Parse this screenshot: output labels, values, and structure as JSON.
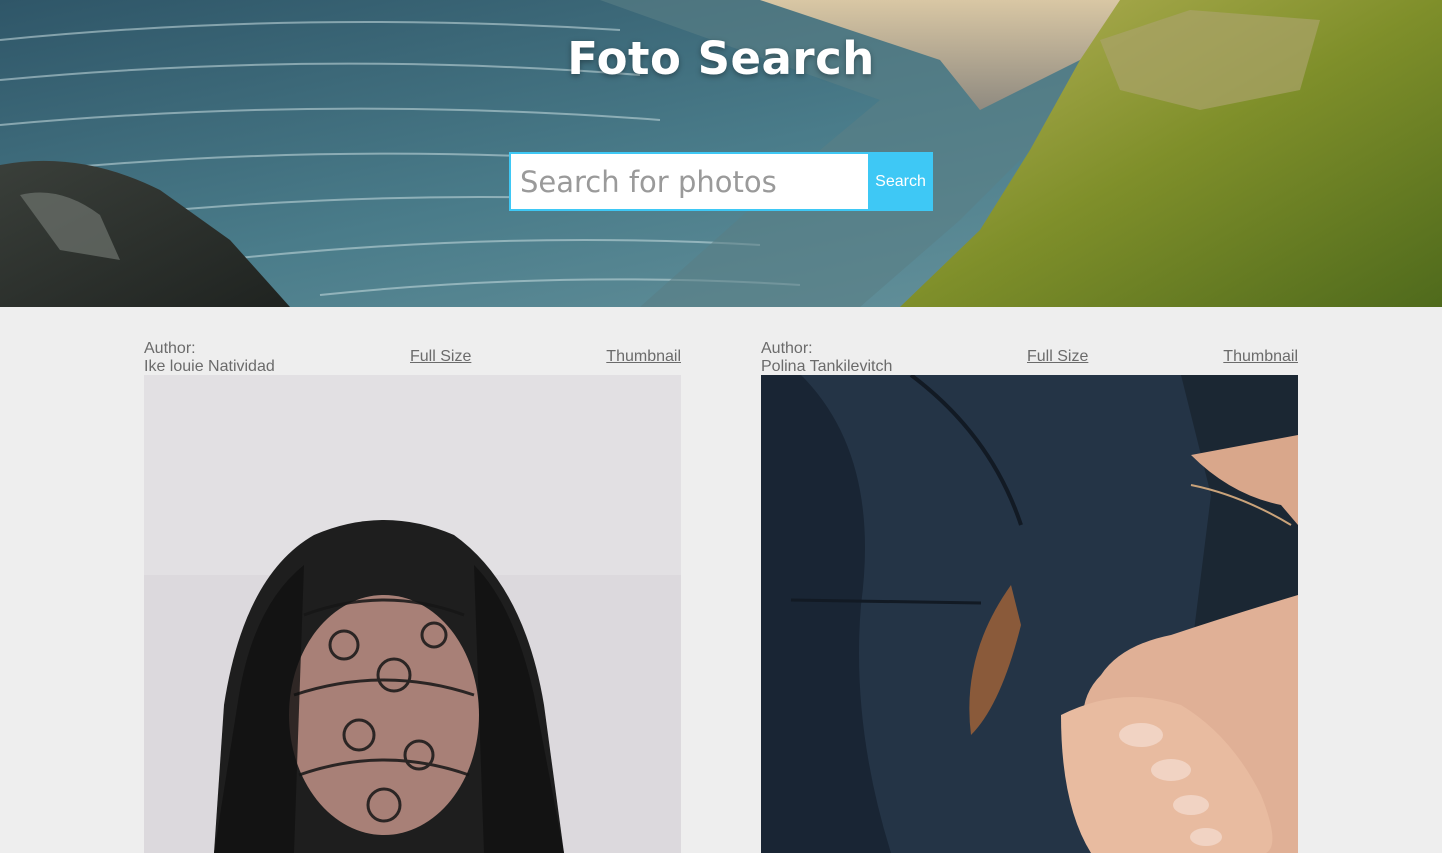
{
  "header": {
    "title": "Foto Search"
  },
  "search": {
    "placeholder": "Search for photos",
    "value": "",
    "button_label": "Search"
  },
  "colors": {
    "accent": "#3ec8f5",
    "page_background": "#eeeeee",
    "meta_text": "#6b6b6b"
  },
  "results": [
    {
      "author_label": "Author:",
      "author_name": "Ike louie Natividad",
      "full_size_label": "Full Size",
      "thumbnail_label": "Thumbnail"
    },
    {
      "author_label": "Author:",
      "author_name": "Polina Tankilevitch",
      "full_size_label": "Full Size",
      "thumbnail_label": "Thumbnail"
    }
  ]
}
